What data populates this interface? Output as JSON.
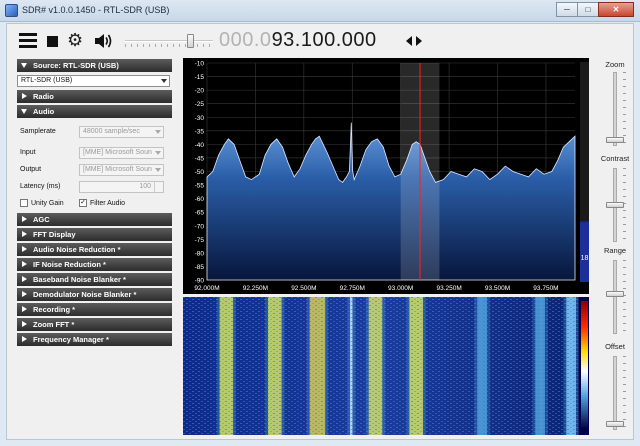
{
  "window": {
    "title": "SDR# v1.0.0.1450 - RTL-SDR (USB)"
  },
  "toolbar": {
    "frequency_dim": "000.0",
    "frequency_lit": "93.100.000",
    "volume_level": 0.76
  },
  "source": {
    "header": "Source: RTL-SDR (USB)",
    "device": "RTL-SDR (USB)"
  },
  "sections": {
    "radio": "Radio",
    "audio": "Audio",
    "agc": "AGC",
    "fft_display": "FFT Display",
    "audio_noise_reduction": "Audio Noise Reduction *",
    "if_noise_reduction": "IF Noise Reduction *",
    "baseband_noise_blanker": "Baseband Noise Blanker *",
    "demodulator_noise_blanker": "Demodulator Noise Blanker *",
    "recording": "Recording *",
    "zoom_fft": "Zoom FFT *",
    "frequency_manager": "Frequency Manager *"
  },
  "audio": {
    "samplerate_label": "Samplerate",
    "samplerate_value": "48000 sample/sec",
    "input_label": "Input",
    "input_value": "[MME] Microsoft Soun",
    "output_label": "Output",
    "output_value": "[MME] Microsoft Soun",
    "latency_label": "Latency (ms)",
    "latency_value": "100",
    "unity_gain_label": "Unity Gain",
    "unity_gain_checked": false,
    "filter_audio_label": "Filter Audio",
    "filter_audio_checked": true
  },
  "spectrum": {
    "y_ticks": [
      "-10",
      "-15",
      "-20",
      "-25",
      "-30",
      "-35",
      "-40",
      "-45",
      "-50",
      "-55",
      "-60",
      "-65",
      "-70",
      "-75",
      "-80",
      "-85",
      "-90"
    ],
    "x_ticks": [
      "92.000M",
      "92.250M",
      "92.500M",
      "92.750M",
      "93.000M",
      "93.250M",
      "93.500M",
      "93.750M"
    ],
    "y_range": [
      -90,
      -10
    ],
    "x_range_mhz": [
      92.0,
      93.9
    ],
    "center_mhz": 93.1,
    "filter_bandwidth_mhz": [
      93.0,
      93.2
    ],
    "fine_indicator": "18",
    "spectrum_fill": "#2a5ea8",
    "marker_color": "#ff2020",
    "curve": [
      [
        92.0,
        -52
      ],
      [
        92.03,
        -50
      ],
      [
        92.06,
        -44
      ],
      [
        92.09,
        -40
      ],
      [
        92.11,
        -38
      ],
      [
        92.14,
        -40
      ],
      [
        92.17,
        -46
      ],
      [
        92.2,
        -52
      ],
      [
        92.23,
        -53
      ],
      [
        92.27,
        -51
      ],
      [
        92.3,
        -44
      ],
      [
        92.33,
        -40
      ],
      [
        92.36,
        -38
      ],
      [
        92.39,
        -41
      ],
      [
        92.42,
        -47
      ],
      [
        92.45,
        -52
      ],
      [
        92.48,
        -49
      ],
      [
        92.51,
        -44
      ],
      [
        92.54,
        -40
      ],
      [
        92.56,
        -38
      ],
      [
        92.58,
        -37
      ],
      [
        92.6,
        -40
      ],
      [
        92.62,
        -43
      ],
      [
        92.65,
        -48
      ],
      [
        92.68,
        -53
      ],
      [
        92.7,
        -54
      ],
      [
        92.72,
        -52
      ],
      [
        92.735,
        -50
      ],
      [
        92.745,
        -32
      ],
      [
        92.752,
        -50
      ],
      [
        92.76,
        -53
      ],
      [
        92.79,
        -48
      ],
      [
        92.82,
        -42
      ],
      [
        92.85,
        -39
      ],
      [
        92.88,
        -38
      ],
      [
        92.91,
        -41
      ],
      [
        92.94,
        -48
      ],
      [
        92.97,
        -52
      ],
      [
        93.0,
        -51
      ],
      [
        93.03,
        -46
      ],
      [
        93.06,
        -40
      ],
      [
        93.08,
        -39
      ],
      [
        93.1,
        -40
      ],
      [
        93.12,
        -44
      ],
      [
        93.15,
        -50
      ],
      [
        93.18,
        -54
      ],
      [
        93.22,
        -53
      ],
      [
        93.26,
        -50
      ],
      [
        93.3,
        -51
      ],
      [
        93.34,
        -52
      ],
      [
        93.38,
        -49
      ],
      [
        93.42,
        -50
      ],
      [
        93.46,
        -53
      ],
      [
        93.5,
        -51
      ],
      [
        93.54,
        -48
      ],
      [
        93.58,
        -50
      ],
      [
        93.62,
        -51
      ],
      [
        93.66,
        -52
      ],
      [
        93.7,
        -49
      ],
      [
        93.74,
        -51
      ],
      [
        93.78,
        -50
      ],
      [
        93.81,
        -46
      ],
      [
        93.84,
        -41
      ],
      [
        93.87,
        -39
      ],
      [
        93.9,
        -37
      ]
    ],
    "waterfall_bands": [
      {
        "mhz": 92.1,
        "width": 0.07,
        "color": "#ffe640"
      },
      {
        "mhz": 92.35,
        "width": 0.07,
        "color": "#ffe640"
      },
      {
        "mhz": 92.57,
        "width": 0.08,
        "color": "#ffd02a"
      },
      {
        "mhz": 92.745,
        "width": 0.012,
        "color": "#ffffff"
      },
      {
        "mhz": 92.87,
        "width": 0.07,
        "color": "#ffe640"
      },
      {
        "mhz": 93.08,
        "width": 0.07,
        "color": "#ffe640"
      },
      {
        "mhz": 93.42,
        "width": 0.05,
        "color": "#4f9ad8"
      },
      {
        "mhz": 93.72,
        "width": 0.05,
        "color": "#4f9ad8"
      },
      {
        "mhz": 93.88,
        "width": 0.05,
        "color": "#8fd0ff"
      }
    ]
  },
  "right_panel": {
    "zoom_label": "Zoom",
    "zoom_level": 0.95,
    "contrast_label": "Contrast",
    "contrast_level": 0.5,
    "range_label": "Range",
    "range_level": 0.45,
    "offset_label": "Offset",
    "offset_level": 0.95
  }
}
